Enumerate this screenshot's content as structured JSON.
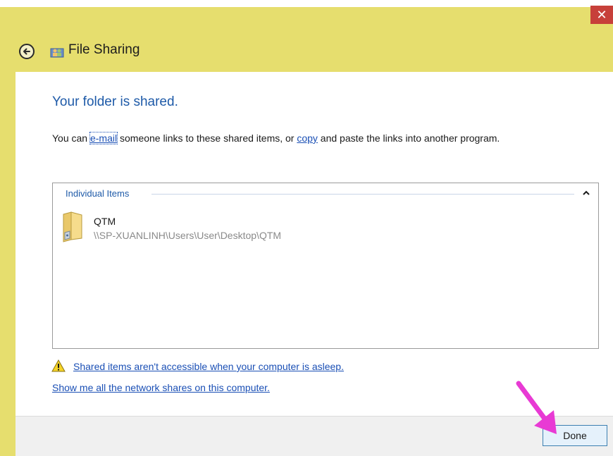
{
  "window": {
    "title": "File Sharing",
    "close_label": "✕"
  },
  "main": {
    "heading": "Your folder is shared.",
    "desc_prefix": "You can ",
    "email_link": "e-mail",
    "desc_middle": " someone links to these shared items, or ",
    "copy_link": "copy",
    "desc_suffix": " and paste the links into another program."
  },
  "items_group": {
    "label": "Individual Items",
    "items": [
      {
        "name": "QTM",
        "path": "\\\\SP-XUANLINH\\Users\\User\\Desktop\\QTM"
      }
    ]
  },
  "links": {
    "warning": "Shared items aren't accessible when your computer is asleep.",
    "network_shares": "Show me all the network shares on this computer."
  },
  "footer": {
    "done_label": "Done"
  },
  "colors": {
    "frame": "#e6de6e",
    "accent": "#1e5aa8",
    "link": "#1a4fb5",
    "close": "#c7403a",
    "arrow": "#e83ad4"
  }
}
